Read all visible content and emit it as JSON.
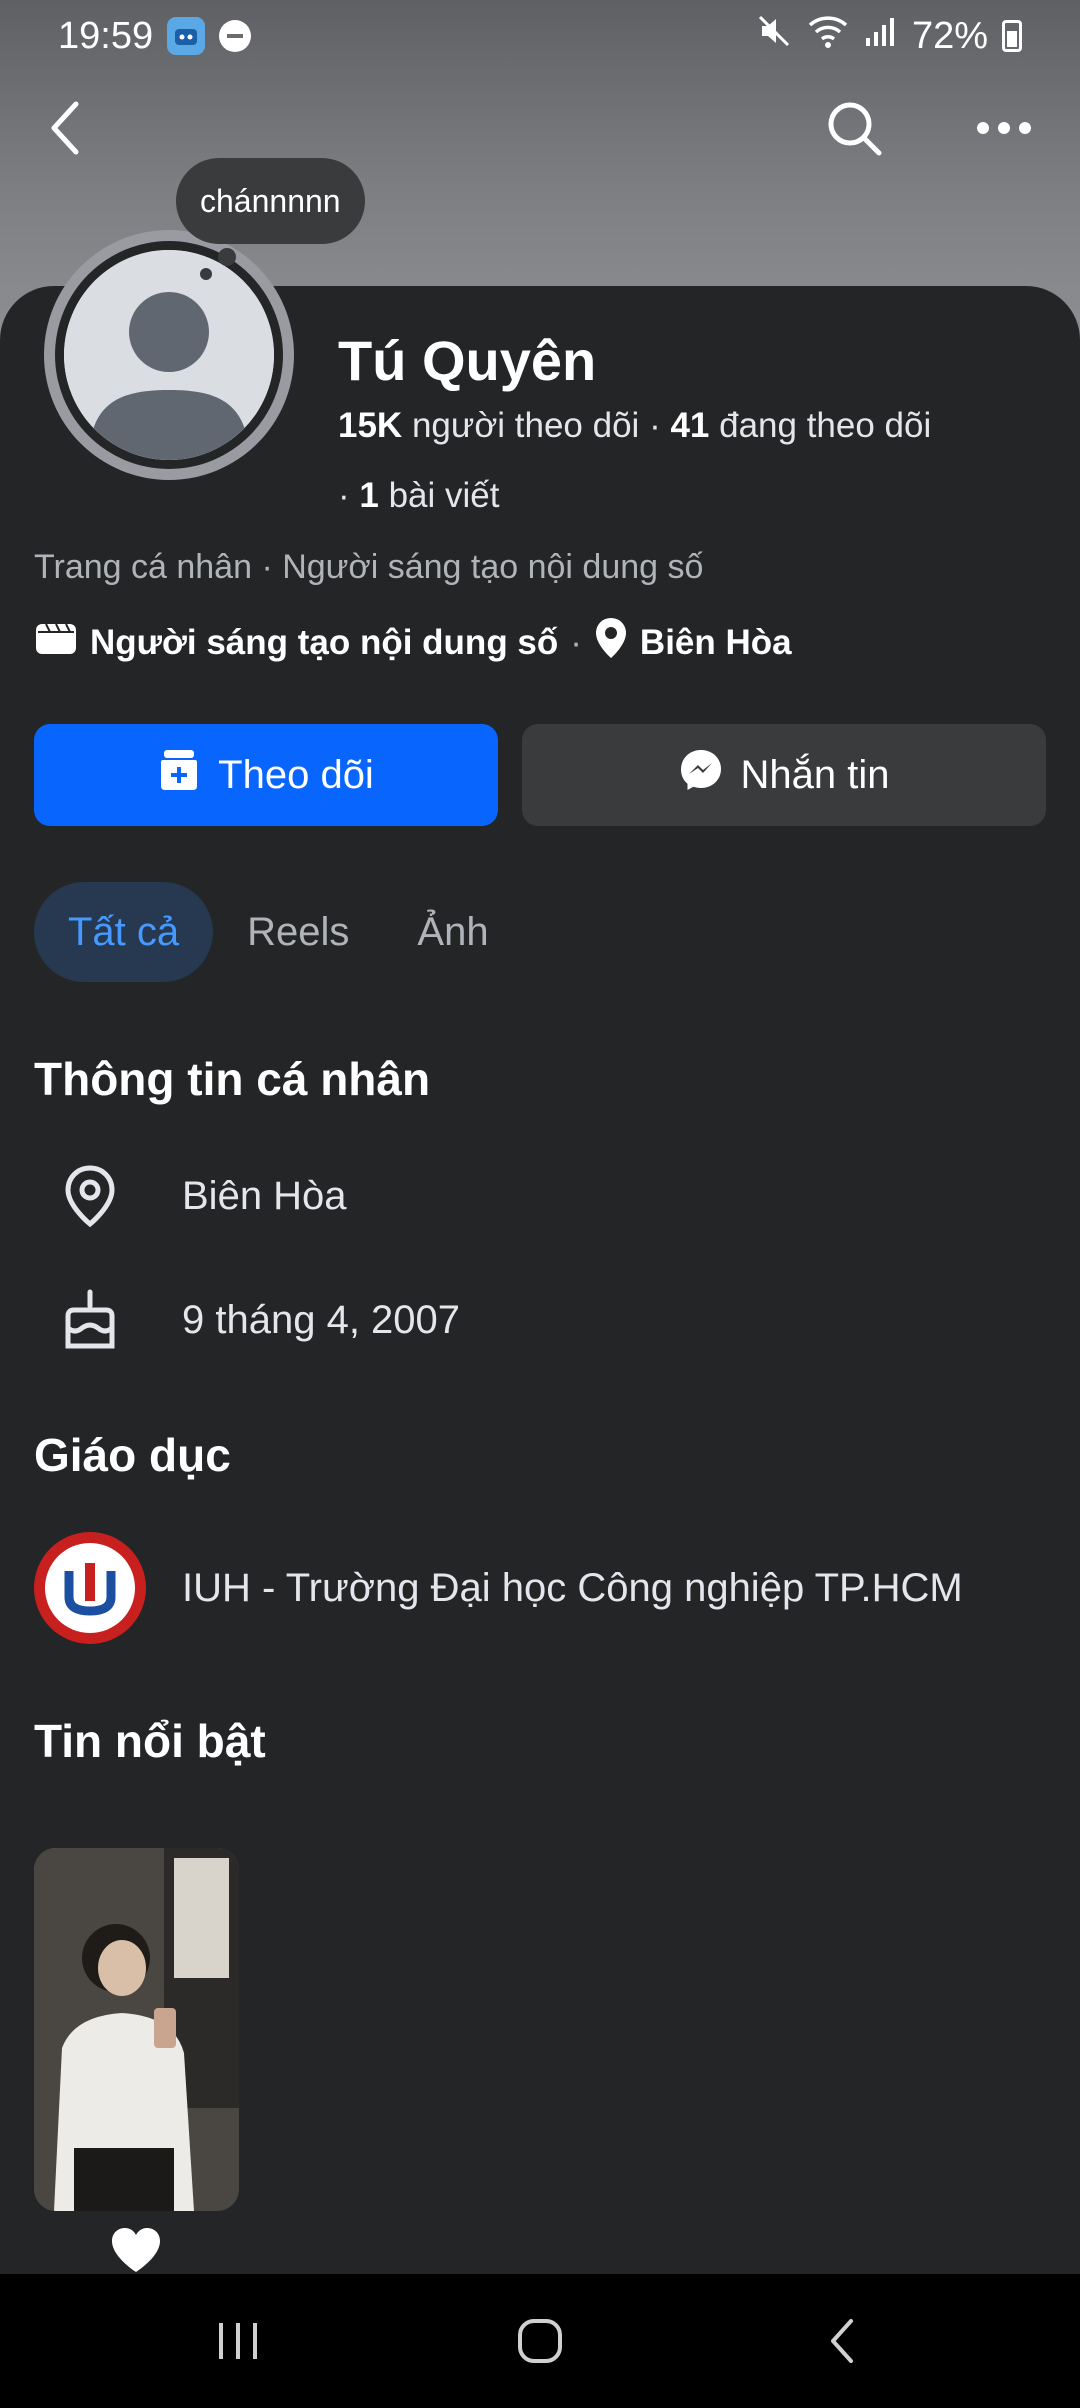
{
  "status_bar": {
    "time": "19:59",
    "battery": "72%",
    "icons": [
      "app-notification-icon",
      "do-not-disturb-icon",
      "mute-icon",
      "wifi-icon",
      "signal-icon",
      "battery-icon"
    ]
  },
  "note": {
    "text": "chánnnnn"
  },
  "profile": {
    "name": "Tú Quyên",
    "followers_count": "15K",
    "followers_label": "người theo dõi",
    "following_count": "41",
    "following_label": "đang theo dõi",
    "posts_count": "1",
    "posts_label": "bài viết",
    "category": "Trang cá nhân · Người sáng tạo nội dung số",
    "creator_label": "Người sáng tạo nội dung số",
    "location": "Biên Hòa"
  },
  "actions": {
    "follow_label": "Theo dõi",
    "message_label": "Nhắn tin"
  },
  "tabs": [
    {
      "label": "Tất cả",
      "active": true
    },
    {
      "label": "Reels",
      "active": false
    },
    {
      "label": "Ảnh",
      "active": false
    }
  ],
  "personal_info": {
    "title": "Thông tin cá nhân",
    "location": "Biên Hòa",
    "birthday": "9 tháng 4, 2007"
  },
  "education": {
    "title": "Giáo dục",
    "school": "IUH - Trường Đại học Công nghiệp TP.HCM"
  },
  "highlights": {
    "title": "Tin nổi bật",
    "items": [
      {
        "icon": "heart-icon"
      }
    ]
  },
  "colors": {
    "background": "#242527",
    "accent_blue": "#0866ff",
    "active_tab_bg": "#263951",
    "active_tab_text": "#4599ff",
    "secondary_button": "#3a3b3d"
  }
}
